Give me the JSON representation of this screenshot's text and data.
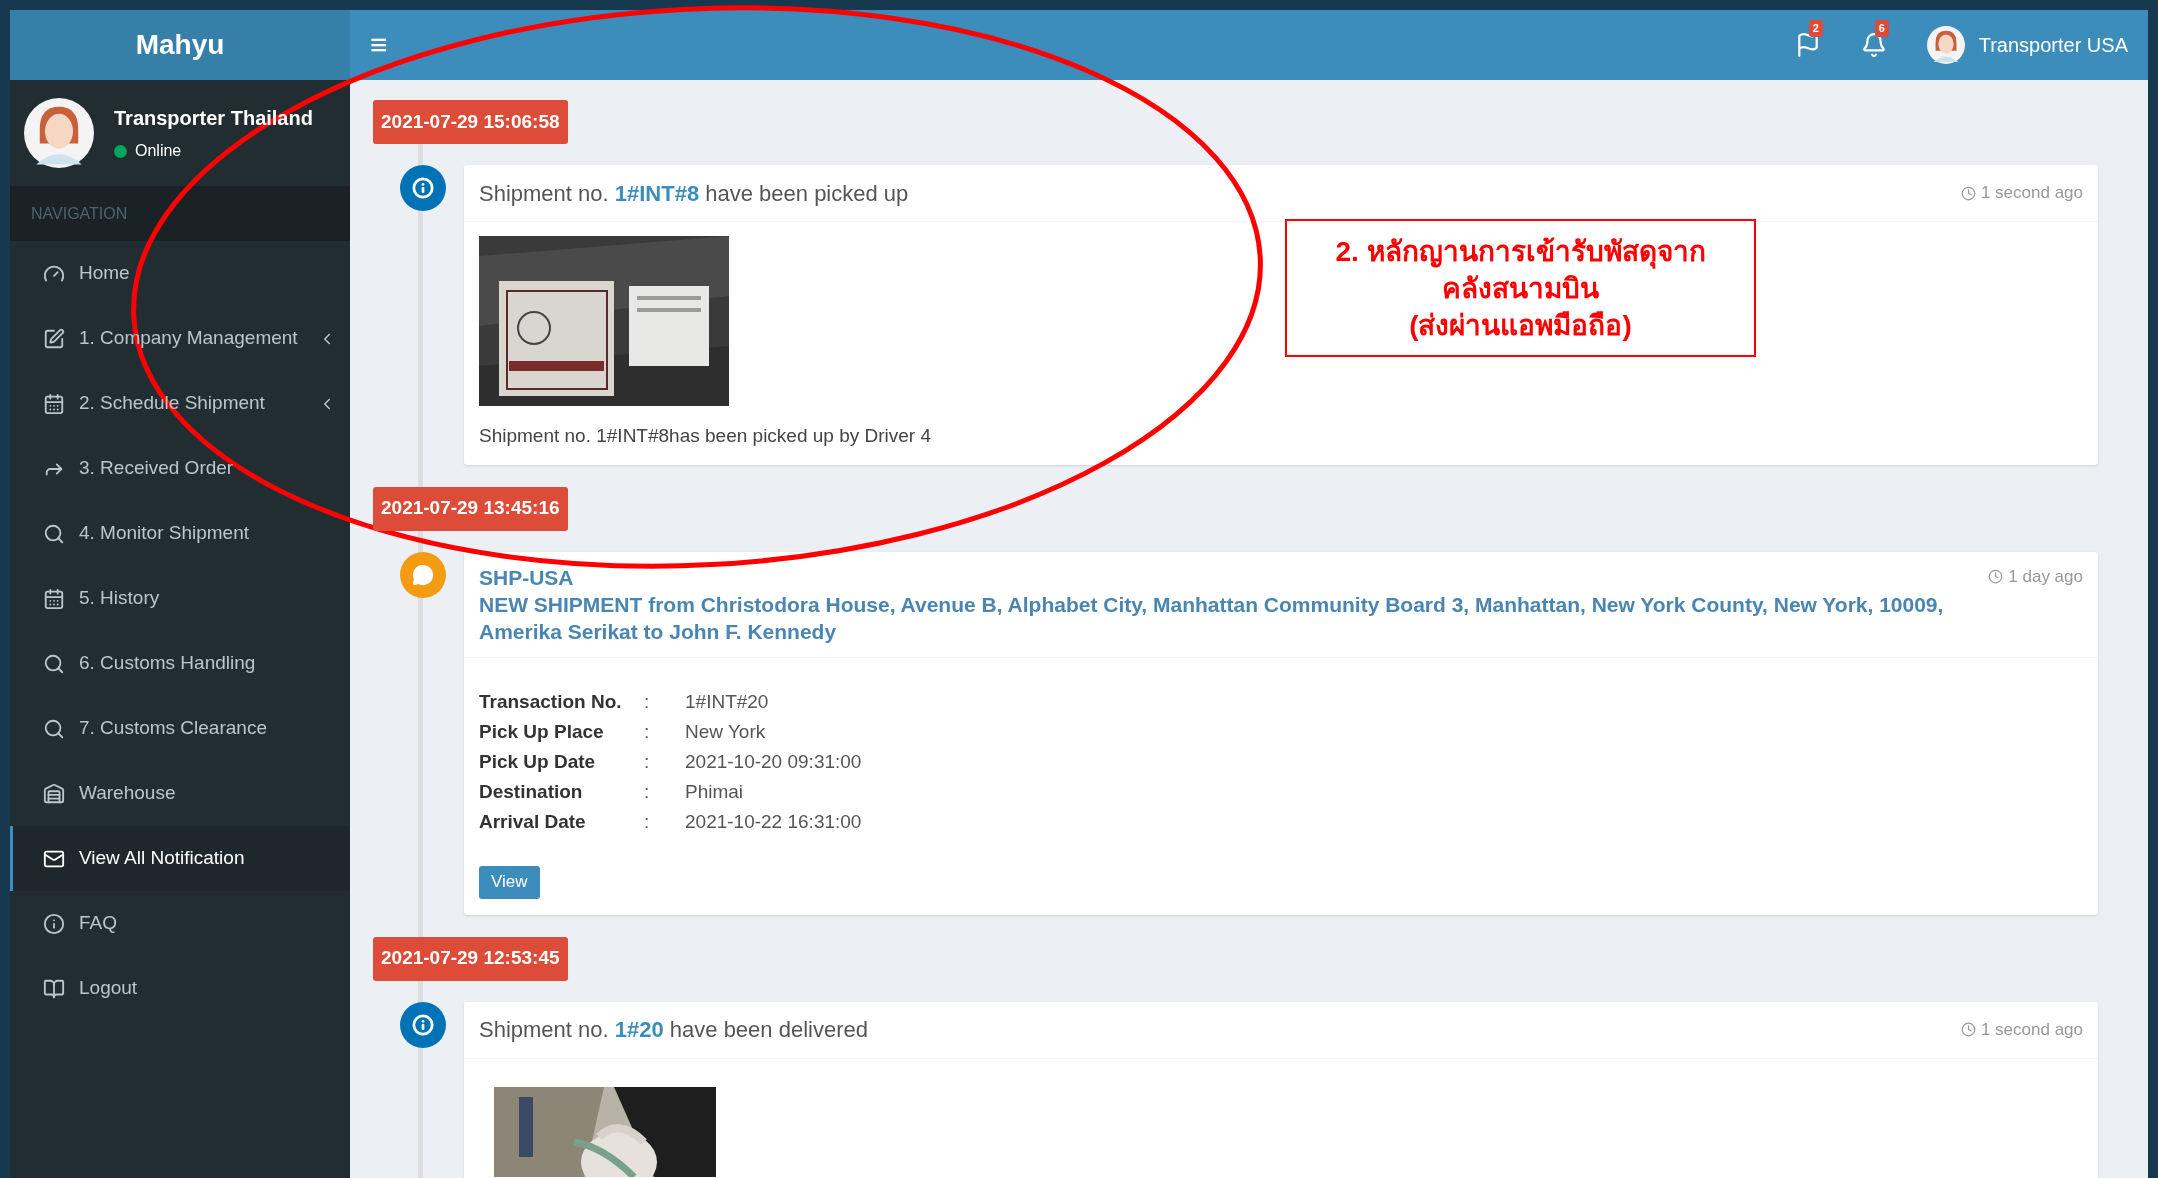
{
  "brand": "Mahyu",
  "header": {
    "menu_glyph": "≡",
    "flag_badge": "2",
    "bell_badge": "6",
    "user": "Transporter USA"
  },
  "user_panel": {
    "name": "Transporter Thailand",
    "status": "Online",
    "online": true
  },
  "nav_header": "NAVIGATION",
  "sidebar": {
    "items": [
      {
        "label": "Home",
        "selected": false,
        "has_submenu": false
      },
      {
        "label": "1. Company Management",
        "selected": false,
        "has_submenu": true
      },
      {
        "label": "2. Schedule Shipment",
        "selected": false,
        "has_submenu": true
      },
      {
        "label": "3. Received Order",
        "selected": false,
        "has_submenu": false
      },
      {
        "label": "4. Monitor Shipment",
        "selected": false,
        "has_submenu": false
      },
      {
        "label": "5. History",
        "selected": false,
        "has_submenu": false
      },
      {
        "label": "6. Customs Handling",
        "selected": false,
        "has_submenu": false
      },
      {
        "label": "7. Customs Clearance",
        "selected": false,
        "has_submenu": false
      },
      {
        "label": "Warehouse",
        "selected": false,
        "has_submenu": false
      },
      {
        "label": "View All Notification",
        "selected": true,
        "has_submenu": false
      },
      {
        "label": "FAQ",
        "selected": false,
        "has_submenu": false
      },
      {
        "label": "Logout",
        "selected": false,
        "has_submenu": false
      }
    ]
  },
  "timeline": [
    {
      "date": "2021-07-29 15:06:58",
      "item": {
        "kind": "info",
        "prefix": "Shipment no. ",
        "link": "1#INT#8",
        "suffix": " have been picked up",
        "time": "1 second ago",
        "caption": "Shipment no. 1#INT#8has been picked up by Driver 4"
      }
    },
    {
      "date": "2021-07-29 13:45:16",
      "item": {
        "kind": "message",
        "title": "SHP-USA",
        "subtitle": "NEW SHIPMENT from Christodora House, Avenue B, Alphabet City, Manhattan Community Board 3, Manhattan, New York County, New York, 10009, Amerika Serikat to John F. Kennedy",
        "time": "1 day ago",
        "details": [
          {
            "label": "Transaction No.",
            "sep": ":",
            "value": "1#INT#20"
          },
          {
            "label": "Pick Up Place",
            "sep": ":",
            "value": "New York"
          },
          {
            "label": "Pick Up Date",
            "sep": ":",
            "value": "2021-10-20 09:31:00"
          },
          {
            "label": "Destination",
            "sep": ":",
            "value": "Phimai"
          },
          {
            "label": "Arrival Date",
            "sep": ":",
            "value": "2021-10-22 16:31:00"
          }
        ],
        "button": "View"
      }
    },
    {
      "date": "2021-07-29 12:53:45",
      "item": {
        "kind": "info",
        "prefix": "Shipment no. ",
        "link": "1#20",
        "suffix": " have been delivered",
        "time": "1 second ago"
      }
    }
  ],
  "annotation": {
    "lines": [
      "2. หลักญานการเข้ารับพัสดุจาก",
      "คลังสนามบิน",
      "(ส่งผ่านแอพมือถือ)"
    ]
  }
}
